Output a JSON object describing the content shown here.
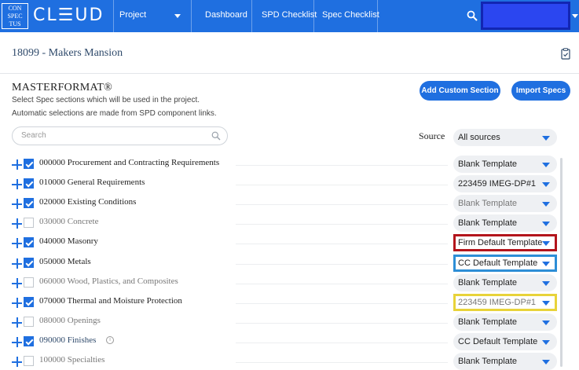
{
  "brand": {
    "logo_box_lines": [
      "CON",
      "SPEC",
      "TUS"
    ],
    "logo_word": "CL☰UD"
  },
  "nav": {
    "project_label": "Project",
    "dashboard_label": "Dashboard",
    "spd_checklist_label": "SPD Checklist",
    "spec_checklist_label": "Spec Checklist"
  },
  "project": {
    "title": "18099 - Makers Mansion"
  },
  "masterformat": {
    "title": "MASTERFORMAT®",
    "subtitle_1": "Select Spec sections which will be used in the project.",
    "subtitle_2": "Automatic selections are made from SPD component links.",
    "add_custom_label": "Add Custom Section",
    "import_specs_label": "Import Specs"
  },
  "search": {
    "placeholder": "Search"
  },
  "source": {
    "label": "Source",
    "value": "All sources"
  },
  "colors": {
    "brand_blue": "#1f6fe0",
    "highlight_red": "#b3151c",
    "highlight_blue": "#2d8ed6",
    "highlight_yellow": "#e8d33a"
  },
  "rows": [
    {
      "label": "000000 Procurement and Contracting Requirements",
      "checked": true,
      "template": "Blank Template",
      "template_muted": false,
      "highlight": ""
    },
    {
      "label": "010000 General Requirements",
      "checked": true,
      "template": "223459 IMEG-DP#1",
      "template_muted": false,
      "highlight": ""
    },
    {
      "label": "020000 Existing Conditions",
      "checked": true,
      "template": "Blank Template",
      "template_muted": true,
      "highlight": ""
    },
    {
      "label": "030000 Concrete",
      "checked": false,
      "template": "Blank Template",
      "template_muted": false,
      "highlight": ""
    },
    {
      "label": "040000 Masonry",
      "checked": true,
      "template": "Firm Default Template",
      "template_muted": false,
      "highlight": "red"
    },
    {
      "label": "050000 Metals",
      "checked": true,
      "template": "CC Default Template",
      "template_muted": false,
      "highlight": "blue"
    },
    {
      "label": "060000 Wood, Plastics, and Composites",
      "checked": false,
      "template": "Blank Template",
      "template_muted": false,
      "highlight": ""
    },
    {
      "label": "070000 Thermal and Moisture Protection",
      "checked": true,
      "template": "223459 IMEG-DP#1",
      "template_muted": true,
      "highlight": "yellow"
    },
    {
      "label": "080000 Openings",
      "checked": false,
      "template": "Blank Template",
      "template_muted": false,
      "highlight": ""
    },
    {
      "label": "090000 Finishes",
      "checked": true,
      "template": "CC Default Template",
      "template_muted": false,
      "highlight": "",
      "link": true,
      "info_icon": "info-icon"
    },
    {
      "label": "100000 Specialties",
      "checked": false,
      "template": "Blank Template",
      "template_muted": false,
      "highlight": ""
    }
  ]
}
